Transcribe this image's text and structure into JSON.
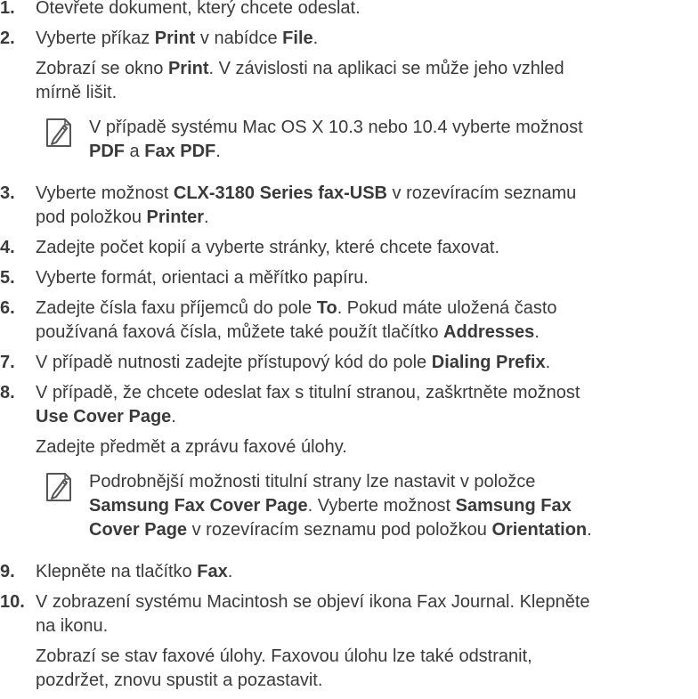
{
  "steps": [
    {
      "num": "1.",
      "lines": [
        [
          {
            "t": "Otevřete dokument, který chcete odeslat.",
            "b": false
          }
        ]
      ]
    },
    {
      "num": "2.",
      "lines": [
        [
          {
            "t": "Vyberte příkaz ",
            "b": false
          },
          {
            "t": "Print",
            "b": true
          },
          {
            "t": " v nabídce ",
            "b": false
          },
          {
            "t": "File",
            "b": true
          },
          {
            "t": ".",
            "b": false
          }
        ]
      ],
      "sub": [
        [
          {
            "t": "Zobrazí se okno ",
            "b": false
          },
          {
            "t": "Print",
            "b": true
          },
          {
            "t": ". V závislosti na aplikaci se může jeho vzhled",
            "b": false
          }
        ],
        [
          {
            "t": "mírně lišit.",
            "b": false
          }
        ]
      ],
      "note": [
        [
          {
            "t": "V případě systému Mac OS X 10.3 nebo 10.4 vyberte možnost",
            "b": false
          }
        ],
        [
          {
            "t": "PDF",
            "b": true
          },
          {
            "t": " a ",
            "b": false
          },
          {
            "t": "Fax PDF",
            "b": true
          },
          {
            "t": ".",
            "b": false
          }
        ]
      ]
    },
    {
      "num": "3.",
      "lines": [
        [
          {
            "t": "Vyberte možnost ",
            "b": false
          },
          {
            "t": "CLX-3180 Series fax-USB",
            "b": true
          },
          {
            "t": " v rozevíracím seznamu",
            "b": false
          }
        ],
        [
          {
            "t": "pod položkou ",
            "b": false
          },
          {
            "t": "Printer",
            "b": true
          },
          {
            "t": ".",
            "b": false
          }
        ]
      ]
    },
    {
      "num": "4.",
      "lines": [
        [
          {
            "t": "Zadejte počet kopií a vyberte stránky, které chcete faxovat.",
            "b": false
          }
        ]
      ]
    },
    {
      "num": "5.",
      "lines": [
        [
          {
            "t": "Vyberte formát, orientaci a měřítko papíru.",
            "b": false
          }
        ]
      ]
    },
    {
      "num": "6.",
      "lines": [
        [
          {
            "t": "Zadejte čísla faxu příjemců do pole ",
            "b": false
          },
          {
            "t": "To",
            "b": true
          },
          {
            "t": ". Pokud máte uložená často",
            "b": false
          }
        ],
        [
          {
            "t": "používaná faxová čísla, můžete také použít tlačítko ",
            "b": false
          },
          {
            "t": "Addresses",
            "b": true
          },
          {
            "t": ".",
            "b": false
          }
        ]
      ]
    },
    {
      "num": "7.",
      "lines": [
        [
          {
            "t": "V případě nutnosti zadejte přístupový kód do pole ",
            "b": false
          },
          {
            "t": "Dialing Prefix",
            "b": true
          },
          {
            "t": ".",
            "b": false
          }
        ]
      ]
    },
    {
      "num": "8.",
      "lines": [
        [
          {
            "t": "V případě, že chcete odeslat fax s titulní stranou, zaškrtněte možnost",
            "b": false
          }
        ],
        [
          {
            "t": "Use Cover Page",
            "b": true
          },
          {
            "t": ".",
            "b": false
          }
        ]
      ],
      "sub": [
        [
          {
            "t": "Zadejte předmět a zprávu faxové úlohy.",
            "b": false
          }
        ]
      ],
      "note": [
        [
          {
            "t": "Podrobnější možnosti titulní strany lze nastavit v položce",
            "b": false
          }
        ],
        [
          {
            "t": "Samsung Fax Cover Page",
            "b": true
          },
          {
            "t": ". Vyberte možnost ",
            "b": false
          },
          {
            "t": "Samsung Fax",
            "b": true
          }
        ],
        [
          {
            "t": "Cover Page",
            "b": true
          },
          {
            "t": " v rozevíracím seznamu pod položkou ",
            "b": false
          },
          {
            "t": "Orientation",
            "b": true
          },
          {
            "t": ".",
            "b": false
          }
        ]
      ]
    },
    {
      "num": "9.",
      "lines": [
        [
          {
            "t": "Klepněte na tlačítko ",
            "b": false
          },
          {
            "t": "Fax",
            "b": true
          },
          {
            "t": ".",
            "b": false
          }
        ]
      ]
    },
    {
      "num": "10.",
      "lines": [
        [
          {
            "t": "V zobrazení systému Macintosh se objeví ikona Fax Journal. Klepněte",
            "b": false
          }
        ],
        [
          {
            "t": "na ikonu.",
            "b": false
          }
        ]
      ],
      "sub": [
        [
          {
            "t": "Zobrazí se stav faxové úlohy. Faxovou úlohu lze také odstranit,",
            "b": false
          }
        ],
        [
          {
            "t": "pozdržet, znovu spustit a pozastavit.",
            "b": false
          }
        ]
      ]
    }
  ],
  "note_icon": "note-pencil-icon"
}
